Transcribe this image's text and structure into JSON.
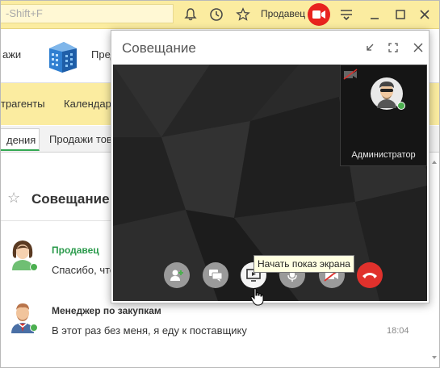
{
  "topbar": {
    "search_placeholder": "-Shift+F",
    "user": "Продавец",
    "icons": [
      "bell-icon",
      "history-icon",
      "star-icon",
      "record-icon",
      "menu-icon",
      "minimize-icon",
      "maximize-icon",
      "close-icon"
    ]
  },
  "sections": {
    "items": [
      {
        "label": "ажи"
      },
      {
        "label": "Пред"
      }
    ]
  },
  "navbar": {
    "items": [
      {
        "label": "трагенты"
      },
      {
        "label": "Календар"
      }
    ]
  },
  "tabs": [
    {
      "label": "дения",
      "active": true
    },
    {
      "label": "Продажи тов",
      "active": false
    }
  ],
  "page": {
    "title": "Совещание"
  },
  "messages": [
    {
      "author": "Продавец",
      "author_color": "#2a9a4b",
      "text": "Спасибо, что",
      "time": ""
    },
    {
      "author": "Менеджер по закупкам",
      "author_color": "#333333",
      "text": "В этот раз без меня, я еду к поставщику",
      "time": "18:04"
    }
  ],
  "dialog": {
    "title": "Совещание",
    "self_name": "Администратор",
    "tooltip": "Начать показ экрана",
    "controls": [
      "add-participant",
      "chat",
      "share-screen",
      "microphone",
      "camera-off",
      "hang-up"
    ]
  }
}
